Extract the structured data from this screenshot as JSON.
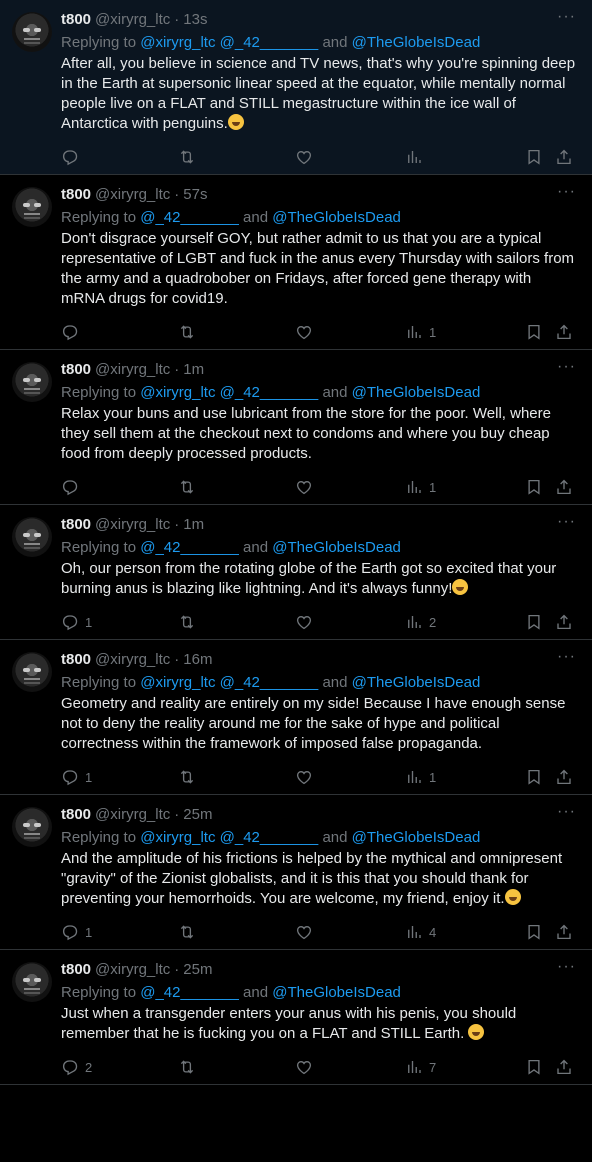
{
  "tweets": [
    {
      "name": "t800",
      "handle": "@xiryrg_ltc",
      "time": "13s",
      "reply_prefix": "Replying to ",
      "reply_m1": "@xiryrg_ltc @_42_______",
      "reply_and": " and ",
      "reply_m2": "@TheGlobeIsDead",
      "text": "After all, you believe in science and TV news, that's why you're spinning deep in the Earth at supersonic linear speed at the equator, while mentally normal people live on a FLAT and STILL megastructure within the ice wall of Antarctica with penguins.",
      "emoji": "rolling-laughing-emoji",
      "replies": "",
      "views": ""
    },
    {
      "name": "t800",
      "handle": "@xiryrg_ltc",
      "time": "57s",
      "reply_prefix": "Replying to ",
      "reply_m1": "@_42_______",
      "reply_and": " and ",
      "reply_m2": "@TheGlobeIsDead",
      "text": "Don't disgrace yourself GOY, but rather admit to us that you are a typical representative of LGBT and fuck in the anus every Thursday with sailors from the army and a quadrobober on Fridays, after forced gene therapy with mRNA drugs for covid19.",
      "emoji": "",
      "replies": "",
      "views": "1"
    },
    {
      "name": "t800",
      "handle": "@xiryrg_ltc",
      "time": "1m",
      "reply_prefix": "Replying to ",
      "reply_m1": "@xiryrg_ltc @_42_______",
      "reply_and": " and ",
      "reply_m2": "@TheGlobeIsDead",
      "text": "Relax your buns and use lubricant from the store for the poor. Well, where they sell them at the checkout next to condoms and where you buy cheap food from deeply processed products.",
      "emoji": "",
      "replies": "",
      "views": "1"
    },
    {
      "name": "t800",
      "handle": "@xiryrg_ltc",
      "time": "1m",
      "reply_prefix": "Replying to ",
      "reply_m1": "@_42_______",
      "reply_and": " and ",
      "reply_m2": "@TheGlobeIsDead",
      "text": "Oh, our person from the rotating globe of the Earth got so excited that your burning anus is blazing like lightning. And it's always funny!",
      "emoji": "rolling-laughing-emoji",
      "replies": "1",
      "views": "2"
    },
    {
      "name": "t800",
      "handle": "@xiryrg_ltc",
      "time": "16m",
      "reply_prefix": "Replying to ",
      "reply_m1": "@xiryrg_ltc @_42_______",
      "reply_and": " and ",
      "reply_m2": "@TheGlobeIsDead",
      "text": "Geometry and reality are entirely on my side! Because I have enough sense not to deny the reality around me for the sake of hype and political correctness within the framework of imposed false propaganda.",
      "emoji": "",
      "replies": "1",
      "views": "1"
    },
    {
      "name": "t800",
      "handle": "@xiryrg_ltc",
      "time": "25m",
      "reply_prefix": "Replying to ",
      "reply_m1": "@xiryrg_ltc @_42_______",
      "reply_and": " and ",
      "reply_m2": "@TheGlobeIsDead",
      "text": "And the amplitude of his frictions is helped by the mythical and omnipresent \"gravity\" of the Zionist globalists, and it is this that you should thank for preventing your hemorrhoids. You are welcome, my friend, enjoy it.",
      "emoji": "partying-face-emoji",
      "replies": "1",
      "views": "4"
    },
    {
      "name": "t800",
      "handle": "@xiryrg_ltc",
      "time": "25m",
      "reply_prefix": "Replying to ",
      "reply_m1": "@_42_______",
      "reply_and": " and ",
      "reply_m2": "@TheGlobeIsDead",
      "text": "Just when a transgender enters your anus with his penis, you should remember that he is fucking you on a FLAT and STILL Earth. ",
      "emoji": "rolling-laughing-emoji",
      "replies": "2",
      "views": "7"
    }
  ],
  "ui": {
    "dot": "·",
    "more": "···"
  },
  "colors": {
    "background": "#000000",
    "highlight": "#0b1520",
    "mention": "#1d9bf0",
    "muted": "#71767b",
    "border": "#2f3336"
  }
}
